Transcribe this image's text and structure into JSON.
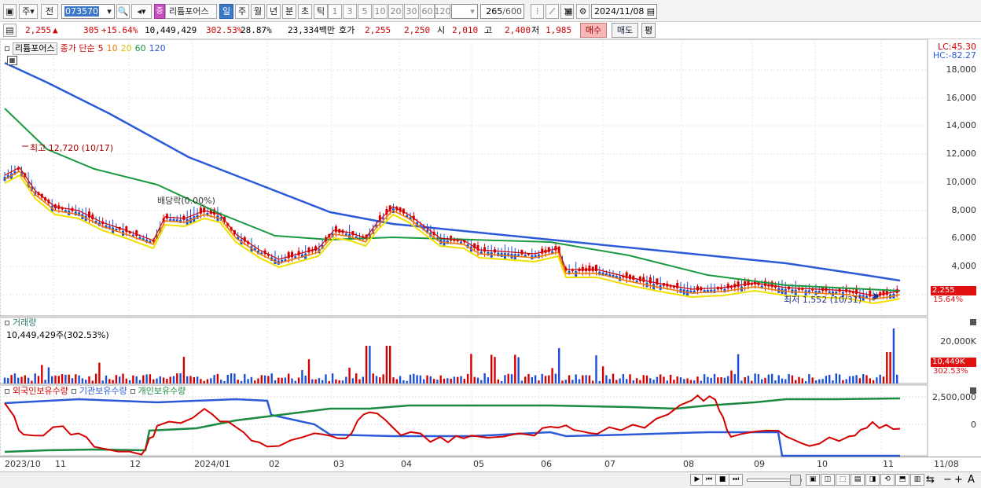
{
  "toolbar": {
    "market_btn": "주",
    "market_dd": "▾",
    "all_btn": "전",
    "code": "073570",
    "stock_name": "리튬포어스",
    "period_labels": [
      "일",
      "주",
      "월",
      "년",
      "분",
      "초",
      "틱"
    ],
    "minute_options": [
      "1",
      "3",
      "5",
      "10",
      "20",
      "30",
      "60",
      "120"
    ],
    "count_value": "265",
    "count_max": "/600",
    "date": "2024/11/08"
  },
  "quote": {
    "price": "2,255",
    "change": "305",
    "change_pct": "+15.64%",
    "volume": "10,449,429",
    "vol_ratio": "302.53%",
    "turnover": "28.87%",
    "amount": "23,334백만",
    "bid_label": "호가",
    "ask1": "2,255",
    "bid1": "2,250",
    "open_label": "시",
    "open": "2,010",
    "high_label": "고",
    "high": "2,400",
    "low_label": "저",
    "low": "1,985",
    "buy_btn": "매수",
    "sell_btn": "매도",
    "eval_btn": "평"
  },
  "price_pane": {
    "legend_name": "리튬포어스",
    "legend_prefix": "종가 단순",
    "ma_labels": [
      "5",
      "10",
      "20",
      "60",
      "120"
    ],
    "ma_colors": [
      "#d40000",
      "#f07800",
      "#f0e000",
      "#1a9a40",
      "#2a5ad8"
    ],
    "lc": "LC:45.30",
    "hc": "HC:-82.27",
    "y_labels": [
      "18,000",
      "16,000",
      "14,000",
      "12,000",
      "10,000",
      "8,000",
      "6,000",
      "4,000"
    ],
    "high_annot": "최고 12,720 (10/17)",
    "low_annot": "최저 1,552 (10/31)",
    "div_annot": "배당락(0.00%)",
    "current_price_tag": "2,255",
    "current_pct_tag": "15.64%"
  },
  "volume_pane": {
    "title": "거래량",
    "subtitle": "10,449,429주(302.53%)",
    "y_label": "20,000K",
    "tag_value": "10,449K",
    "tag_pct": "302.53%"
  },
  "holding_pane": {
    "legend": [
      "외국인보유수량",
      "기관보유수량",
      "개인보유수량"
    ],
    "y_labels": [
      "2,500,000",
      "0"
    ]
  },
  "x_axis": [
    "2023/10",
    "11",
    "12",
    "2024/01",
    "02",
    "03",
    "04",
    "05",
    "06",
    "07",
    "08",
    "09",
    "10",
    "11",
    "11/08"
  ],
  "colors": {
    "up": "#d40000",
    "down": "#1d4fd6",
    "accent": "#3a78c9"
  }
}
